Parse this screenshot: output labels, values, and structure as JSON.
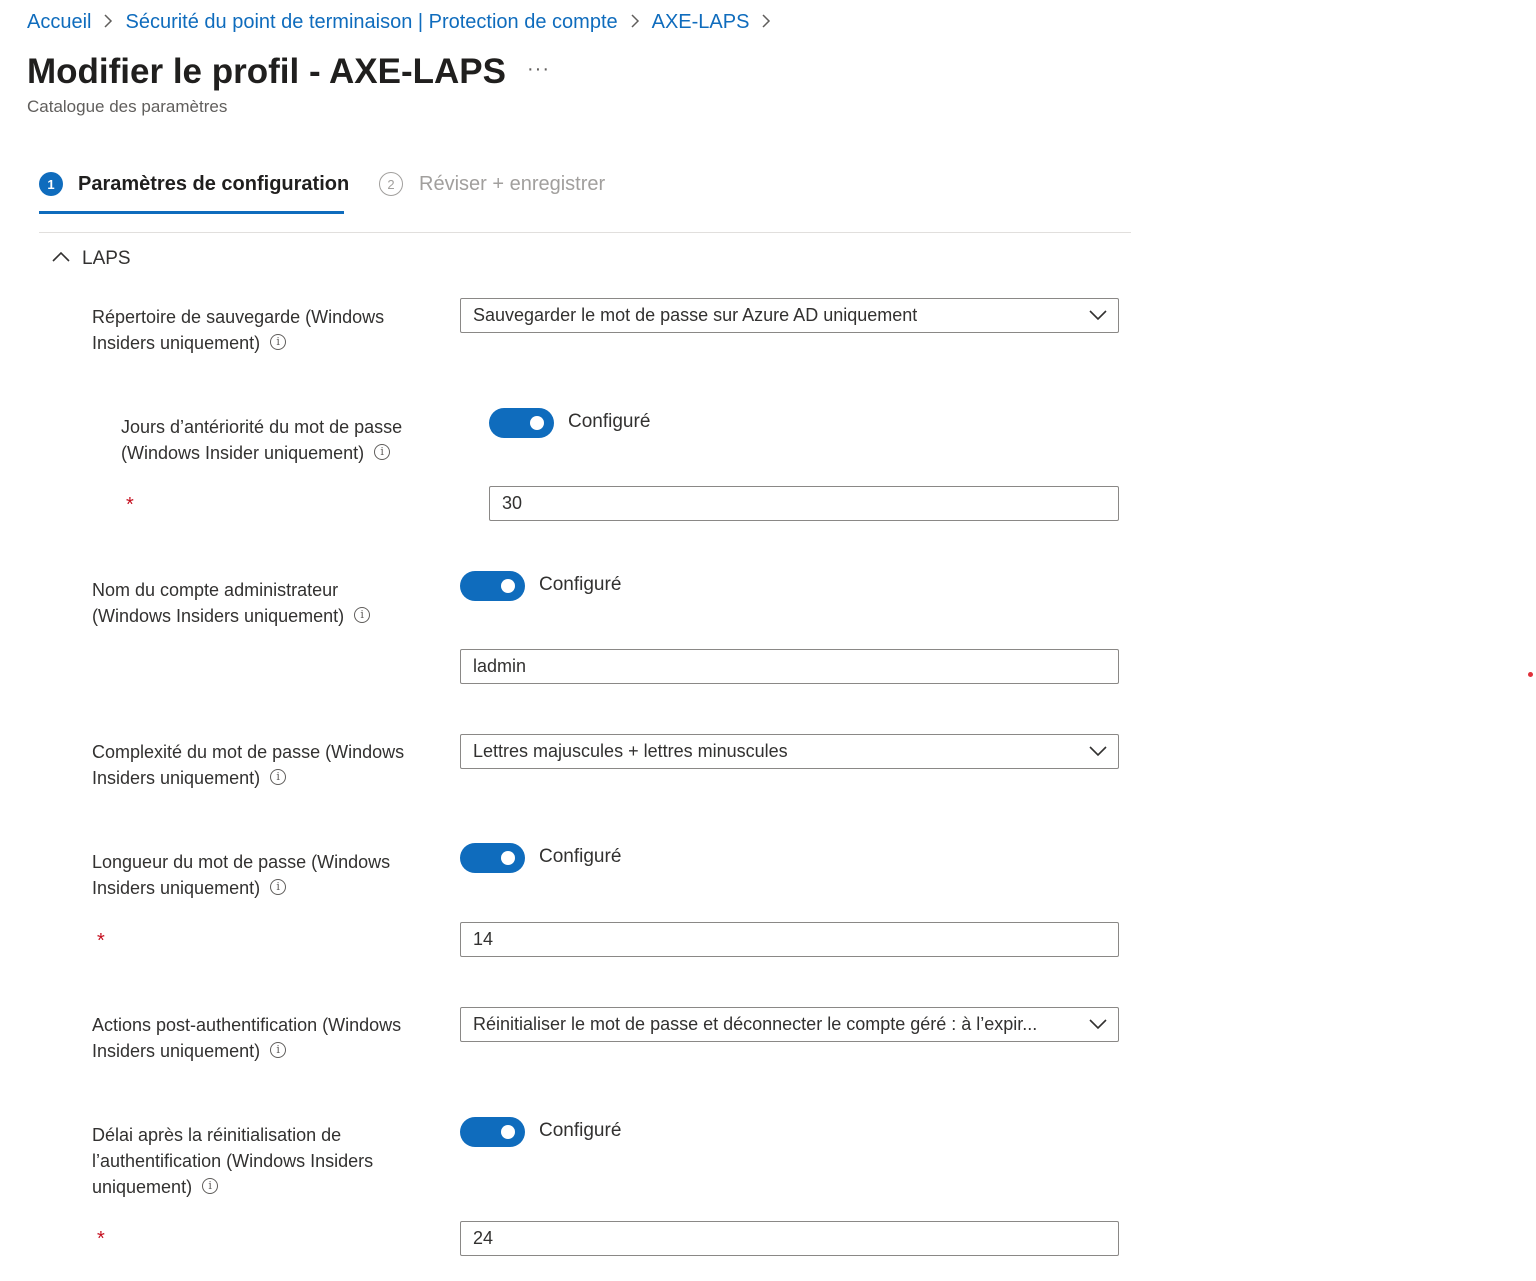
{
  "breadcrumb": {
    "items": [
      "Accueil",
      "Sécurité du point de terminaison | Protection de compte",
      "AXE-LAPS"
    ],
    "separator": ">"
  },
  "page": {
    "title": "Modifier le profil - AXE-LAPS",
    "more": "···",
    "subtitle": "Catalogue des paramètres"
  },
  "tabs": [
    {
      "number": "1",
      "label": "Paramètres de configuration",
      "active": true
    },
    {
      "number": "2",
      "label": "Réviser + enregistrer",
      "active": false
    }
  ],
  "section": {
    "label": "LAPS",
    "expanded": true
  },
  "settings": {
    "backup_directory": {
      "label_line1": "Répertoire de sauvegarde (Windows",
      "label_line2": "Insiders uniquement)",
      "value": "Sauvegarder le mot de passe sur Azure AD uniquement"
    },
    "password_age": {
      "label_line1": "Jours d’antériorité du mot de passe",
      "label_line2": "(Windows Insider uniquement)",
      "toggle_label": "Configuré",
      "toggle_on": true,
      "required_mark": "*",
      "value": "30"
    },
    "admin_account": {
      "label_line1": "Nom du compte administrateur",
      "label_line2": "(Windows Insiders uniquement)",
      "toggle_label": "Configuré",
      "toggle_on": true,
      "value": "ladmin"
    },
    "password_complexity": {
      "label_line1": "Complexité du mot de passe (Windows",
      "label_line2": "Insiders uniquement)",
      "value": "Lettres majuscules + lettres minuscules"
    },
    "password_length": {
      "label_line1": "Longueur du mot de passe (Windows",
      "label_line2": "Insiders uniquement)",
      "toggle_label": "Configuré",
      "toggle_on": true,
      "required_mark": "*",
      "value": "14"
    },
    "post_auth_actions": {
      "label_line1": "Actions post-authentification (Windows",
      "label_line2": "Insiders uniquement)",
      "value": "Réinitialiser le mot de passe et déconnecter le compte géré : à l’expir..."
    },
    "post_auth_delay": {
      "label_line1": "Délai après la réinitialisation de",
      "label_line2": "l’authentification (Windows Insiders",
      "label_line3": "uniquement)",
      "toggle_label": "Configuré",
      "toggle_on": true,
      "required_mark": "*",
      "value": "24"
    }
  },
  "icons": {
    "info": "info-icon",
    "chevron": "chevron-down-icon",
    "collapse": "chevron-up-icon"
  },
  "colors": {
    "accent": "#0f6cbd",
    "required": "#c50f1f",
    "border": "#8a8886"
  }
}
